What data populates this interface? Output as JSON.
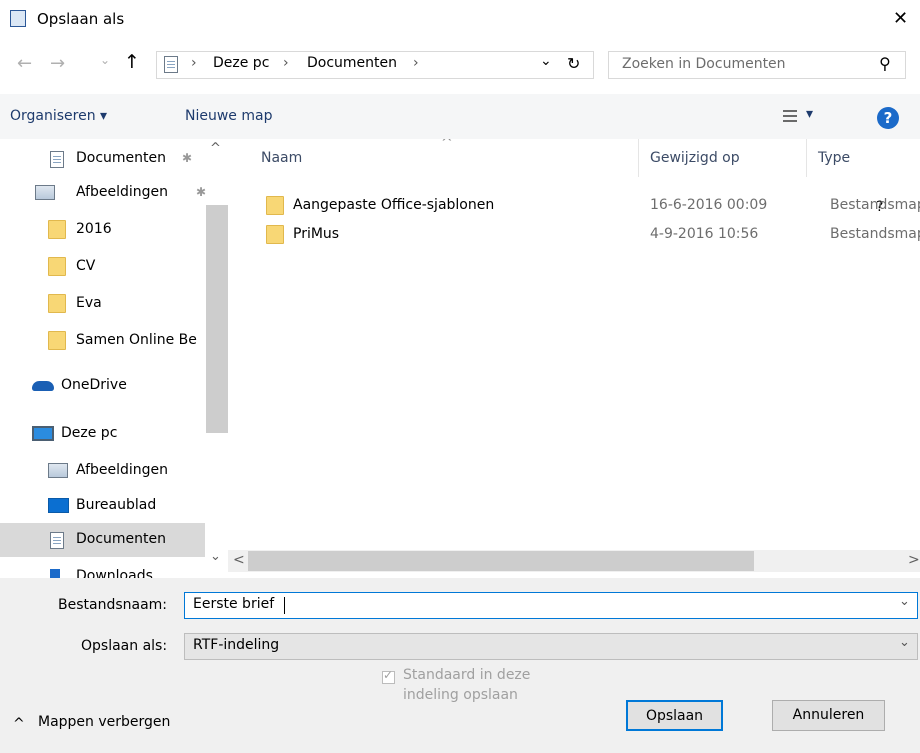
{
  "window": {
    "title": "Opslaan als",
    "close_glyph": "✕"
  },
  "nav": {
    "back": "←",
    "forward": "→",
    "recent": "⌄",
    "up": "↑",
    "breadcrumb": [
      "Deze pc",
      "Documenten"
    ],
    "separator": "›",
    "dropdown": "⌄",
    "refresh": "↻",
    "search_placeholder": "Zoeken in Documenten",
    "search_glyph": "⚲"
  },
  "toolbar": {
    "organize": "Organiseren ▾",
    "new_folder": "Nieuwe map",
    "view_glyph": "▾",
    "help_glyph": "?"
  },
  "sidebar": {
    "pin": "✱",
    "items": [
      {
        "label": "Documenten",
        "icon": "documents-icon",
        "pinned": true
      },
      {
        "label": "Afbeeldingen",
        "icon": "pictures-icon",
        "pinned": true
      },
      {
        "label": "2016",
        "icon": "folder-icon"
      },
      {
        "label": "CV",
        "icon": "folder-icon"
      },
      {
        "label": "Eva",
        "icon": "folder-icon"
      },
      {
        "label": "Samen Online Be",
        "icon": "folder-icon"
      },
      {
        "label": "OneDrive",
        "icon": "onedrive-icon"
      },
      {
        "label": "Deze pc",
        "icon": "pc-icon"
      },
      {
        "label": "Afbeeldingen",
        "icon": "pictures-icon"
      },
      {
        "label": "Bureaublad",
        "icon": "desktop-icon"
      },
      {
        "label": "Documenten",
        "icon": "documents-icon",
        "selected": true
      },
      {
        "label": "Downloads",
        "icon": "downloads-icon"
      }
    ],
    "scroll_up": "^",
    "scroll_down": "⌄"
  },
  "files": {
    "columns": {
      "name": "Naam",
      "modified": "Gewijzigd op",
      "type": "Type"
    },
    "sort_glyph": "^",
    "rows": [
      {
        "name": "Aangepaste Office-sjablonen",
        "modified": "16-6-2016 00:09",
        "type": "Bestandsmap"
      },
      {
        "name": "PriMus",
        "modified": "4-9-2016 10:56",
        "type": "Bestandsmap"
      }
    ],
    "scroll_left": "<",
    "scroll_right": ">"
  },
  "form": {
    "filename_label": "Bestandsnaam:",
    "filename_value": "Eerste brief",
    "savetype_label": "Opslaan als:",
    "savetype_value": "RTF-indeling",
    "combo_glyph": "⌄"
  },
  "footer": {
    "hide_folders": "Mappen verbergen",
    "hide_glyph": "^",
    "checkbox_line1": "Standaard in deze",
    "checkbox_line2": "indeling opslaan",
    "checkbox_checked": true,
    "check_glyph": "✓",
    "save": "Opslaan",
    "cancel": "Annuleren"
  }
}
